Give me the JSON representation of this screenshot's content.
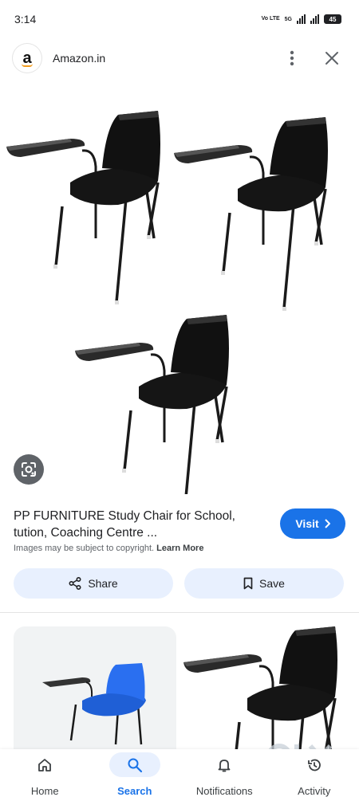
{
  "status_bar": {
    "time": "3:14",
    "network": "Vo LTE",
    "signal_label": "5G",
    "battery": "45"
  },
  "header": {
    "site_name": "Amazon.in",
    "logo_letter": "a",
    "logo_icon": "amazon-logo",
    "more_icon": "more-vert-icon",
    "close_icon": "close-icon"
  },
  "product": {
    "title": "PP FURNITURE Study Chair for School, tution, Coaching Centre ...",
    "visit_label": "Visit",
    "copyright_text": "Images may be subject to copyright.",
    "learn_more_label": "Learn More"
  },
  "actions": {
    "share_label": "Share",
    "save_label": "Save"
  },
  "bottom_nav": {
    "items": [
      {
        "label": "Home",
        "icon": "home-icon"
      },
      {
        "label": "Search",
        "icon": "search-icon",
        "active": true
      },
      {
        "label": "Notifications",
        "icon": "bell-icon"
      },
      {
        "label": "Activity",
        "icon": "history-icon"
      }
    ]
  },
  "colors": {
    "accent": "#1a73e8",
    "action_bg": "#e8f0fe",
    "chair_black": "#151515",
    "chair_blue": "#1f5fd6"
  }
}
